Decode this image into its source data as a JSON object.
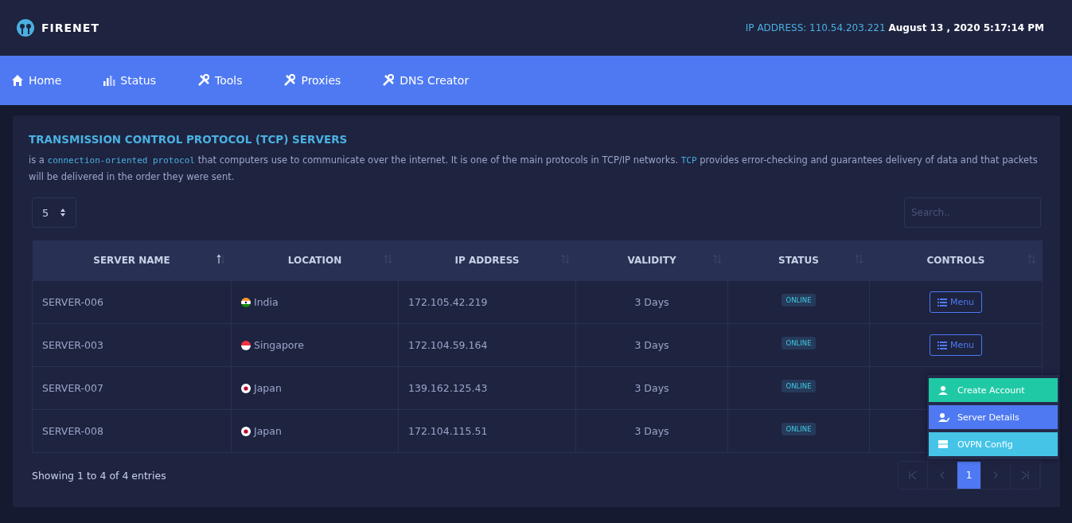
{
  "brand": {
    "name": "FIRENET"
  },
  "header": {
    "ip_label": "IP ADDRESS: 110.54.203.221",
    "datetime": "August 13 , 2020 5:17:14 PM"
  },
  "nav": [
    {
      "label": "Home"
    },
    {
      "label": "Status"
    },
    {
      "label": "Tools"
    },
    {
      "label": "Proxies"
    },
    {
      "label": "DNS Creator"
    }
  ],
  "panel": {
    "title": "TRANSMISSION CONTROL PROTOCOL (TCP) SERVERS",
    "description": [
      {
        "kind": "plain",
        "text": "is a "
      },
      {
        "kind": "code",
        "text": "connection-oriented protocol"
      },
      {
        "kind": "plain",
        "text": " that computers use to communicate over the internet. It is one of the main protocols in TCP/IP networks. "
      },
      {
        "kind": "code",
        "text": "TCP"
      },
      {
        "kind": "plain",
        "text": " provides error-checking and guarantees delivery of data and that packets will be delivered in the order they were sent."
      }
    ],
    "page_size": "5",
    "search": {
      "placeholder": "Search.."
    }
  },
  "table": {
    "columns": [
      {
        "label": "SERVER NAME",
        "sorted": true
      },
      {
        "label": "LOCATION",
        "sorted": false
      },
      {
        "label": "IP ADDRESS",
        "sorted": false
      },
      {
        "label": "VALIDITY",
        "sorted": false
      },
      {
        "label": "STATUS",
        "sorted": false
      },
      {
        "label": "CONTROLS",
        "sorted": false
      }
    ],
    "rows": [
      {
        "name": "SERVER-006",
        "kind": "in",
        "location": "India",
        "ip": "172.105.42.219",
        "validity": "3 Days",
        "status": "ONLINE",
        "menu": "Menu",
        "open": false
      },
      {
        "name": "SERVER-003",
        "kind": "sg",
        "location": "Singapore",
        "ip": "172.104.59.164",
        "validity": "3 Days",
        "status": "ONLINE",
        "menu": "Menu",
        "open": false
      },
      {
        "name": "SERVER-007",
        "kind": "jp",
        "location": "Japan",
        "ip": "139.162.125.43",
        "validity": "3 Days",
        "status": "ONLINE",
        "open": true
      },
      {
        "name": "SERVER-008",
        "kind": "jp",
        "location": "Japan",
        "ip": "172.104.115.51",
        "validity": "3 Days",
        "status": "ONLINE",
        "open": false
      }
    ]
  },
  "dropdown": [
    {
      "label": "Create Account",
      "color": "#20c9a6"
    },
    {
      "label": "Server Details",
      "color": "#4e79f2"
    },
    {
      "label": "OVPN Config",
      "color": "#45c4e8"
    }
  ],
  "footer": {
    "info": "Showing 1 to 4 of 4 entries"
  },
  "pagination": [
    {
      "kind": "first",
      "disabled": true,
      "selected": false
    },
    {
      "kind": "prev",
      "disabled": true,
      "selected": false
    },
    {
      "kind": "page",
      "label": "1",
      "disabled": false,
      "selected": true
    },
    {
      "kind": "next",
      "disabled": true,
      "selected": false
    },
    {
      "kind": "last",
      "disabled": true,
      "selected": false
    }
  ]
}
